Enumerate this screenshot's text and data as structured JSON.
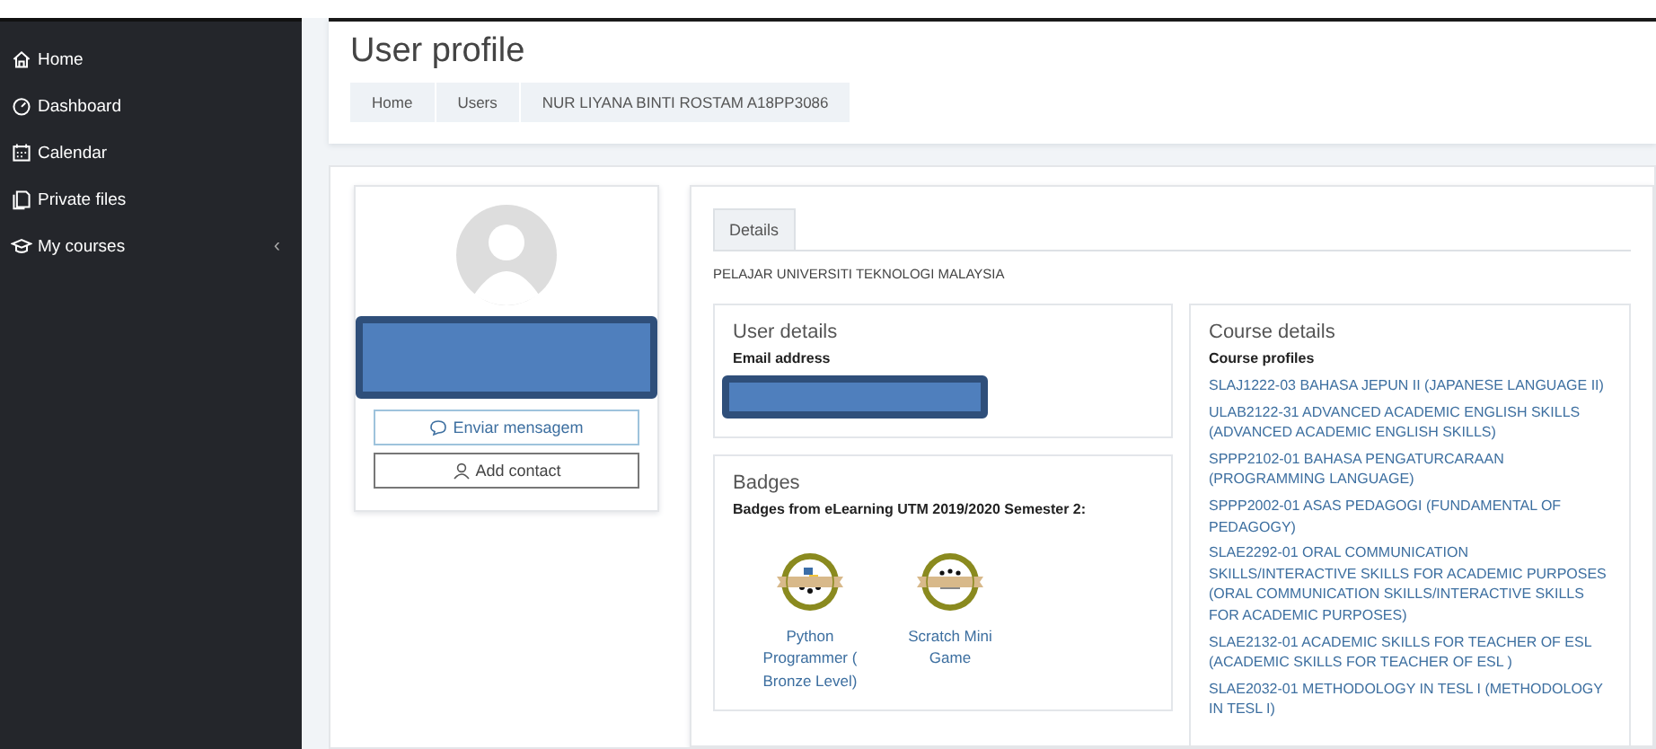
{
  "sidebar": {
    "items": [
      {
        "label": "Home"
      },
      {
        "label": "Dashboard"
      },
      {
        "label": "Calendar"
      },
      {
        "label": "Private files"
      },
      {
        "label": "My courses",
        "expander": "‹"
      }
    ]
  },
  "header": {
    "title": "User profile",
    "breadcrumb": [
      "Home",
      "Users",
      "NUR LIYANA BINTI ROSTAM A18PP3086"
    ]
  },
  "profile": {
    "name_redacted": true,
    "buttons": [
      {
        "label": "Enviar mensagem",
        "kind": "message"
      },
      {
        "label": "Add contact",
        "kind": "contact"
      }
    ]
  },
  "tabs": [
    {
      "label": "Details",
      "selected": true
    }
  ],
  "description": "PELAJAR UNIVERSITI TEKNOLOGI MALAYSIA",
  "user_details": {
    "title": "User details",
    "fields": [
      {
        "label": "Email address",
        "redacted": true
      }
    ]
  },
  "badges": {
    "title": "Badges",
    "subtitle": "Badges from eLearning UTM 2019/2020 Semester 2:",
    "items": [
      {
        "name": "Python Programmer ( Bronze Level)",
        "kind": "python"
      },
      {
        "name": "Scratch Mini Game",
        "kind": "scratch"
      }
    ]
  },
  "course_details": {
    "title": "Course details",
    "subtitle": "Course profiles",
    "courses": [
      "SLAJ1222-03 BAHASA JEPUN II (JAPANESE LANGUAGE II)",
      "ULAB2122-31 ADVANCED ACADEMIC ENGLISH SKILLS (ADVANCED ACADEMIC ENGLISH SKILLS)",
      "SPPP2102-01 BAHASA PENGATURCARAAN (PROGRAMMING LANGUAGE)",
      "SPPP2002-01 ASAS PEDAGOGI (FUNDAMENTAL OF PEDAGOGY)",
      "SLAE2292-01 ORAL COMMUNICATION SKILLS/INTERACTIVE SKILLS FOR ACADEMIC PURPOSES (ORAL COMMUNICATION SKILLS/INTERACTIVE SKILLS FOR ACADEMIC PURPOSES)",
      "SLAE2132-01 ACADEMIC SKILLS FOR TEACHER OF ESL (ACADEMIC SKILLS FOR TEACHER OF ESL )",
      "SLAE2032-01 METHODOLOGY IN TESL I (METHODOLOGY IN TESL I)"
    ]
  }
}
